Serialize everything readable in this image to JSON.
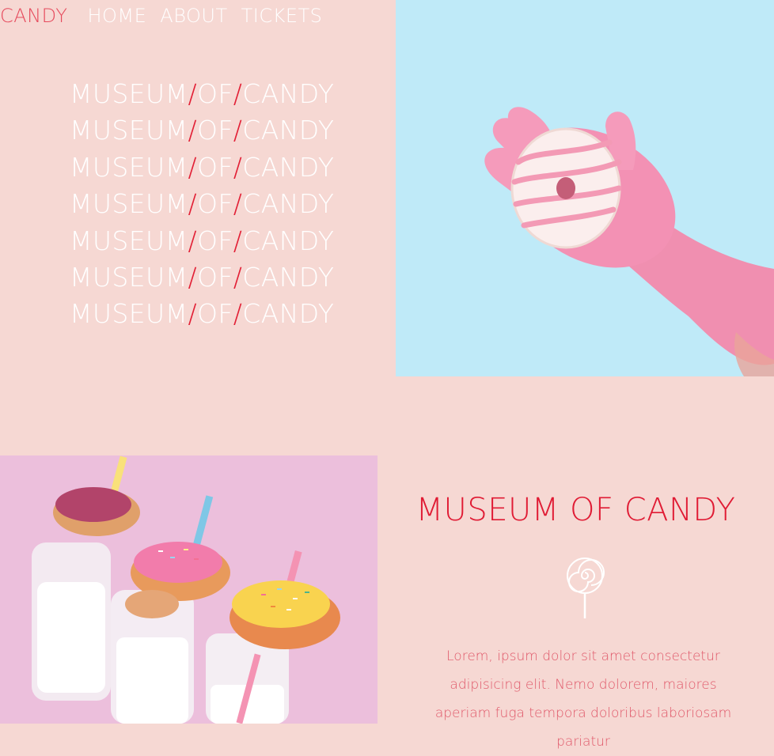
{
  "nav": {
    "brand": "CANDY",
    "links": [
      "HOME",
      "ABOUT",
      "TICKETS"
    ]
  },
  "hero": {
    "stack_parts": [
      "MUSEUM",
      "/",
      "OF",
      "/",
      "CANDY"
    ],
    "repeat": 7
  },
  "info": {
    "title": "MUSEUM OF CANDY",
    "icon": "lollipop-icon",
    "body": "Lorem, ipsum dolor sit amet consectetur adipisicing elit. Nemo dolorem, maiores aperiam fuga tempora doloribus laboriosam pariatur"
  },
  "colors": {
    "background": "#f6d8d3",
    "accent": "#e21f35",
    "sky": "#bfeaf8",
    "pink_photo_bg": "#edc0dc"
  }
}
